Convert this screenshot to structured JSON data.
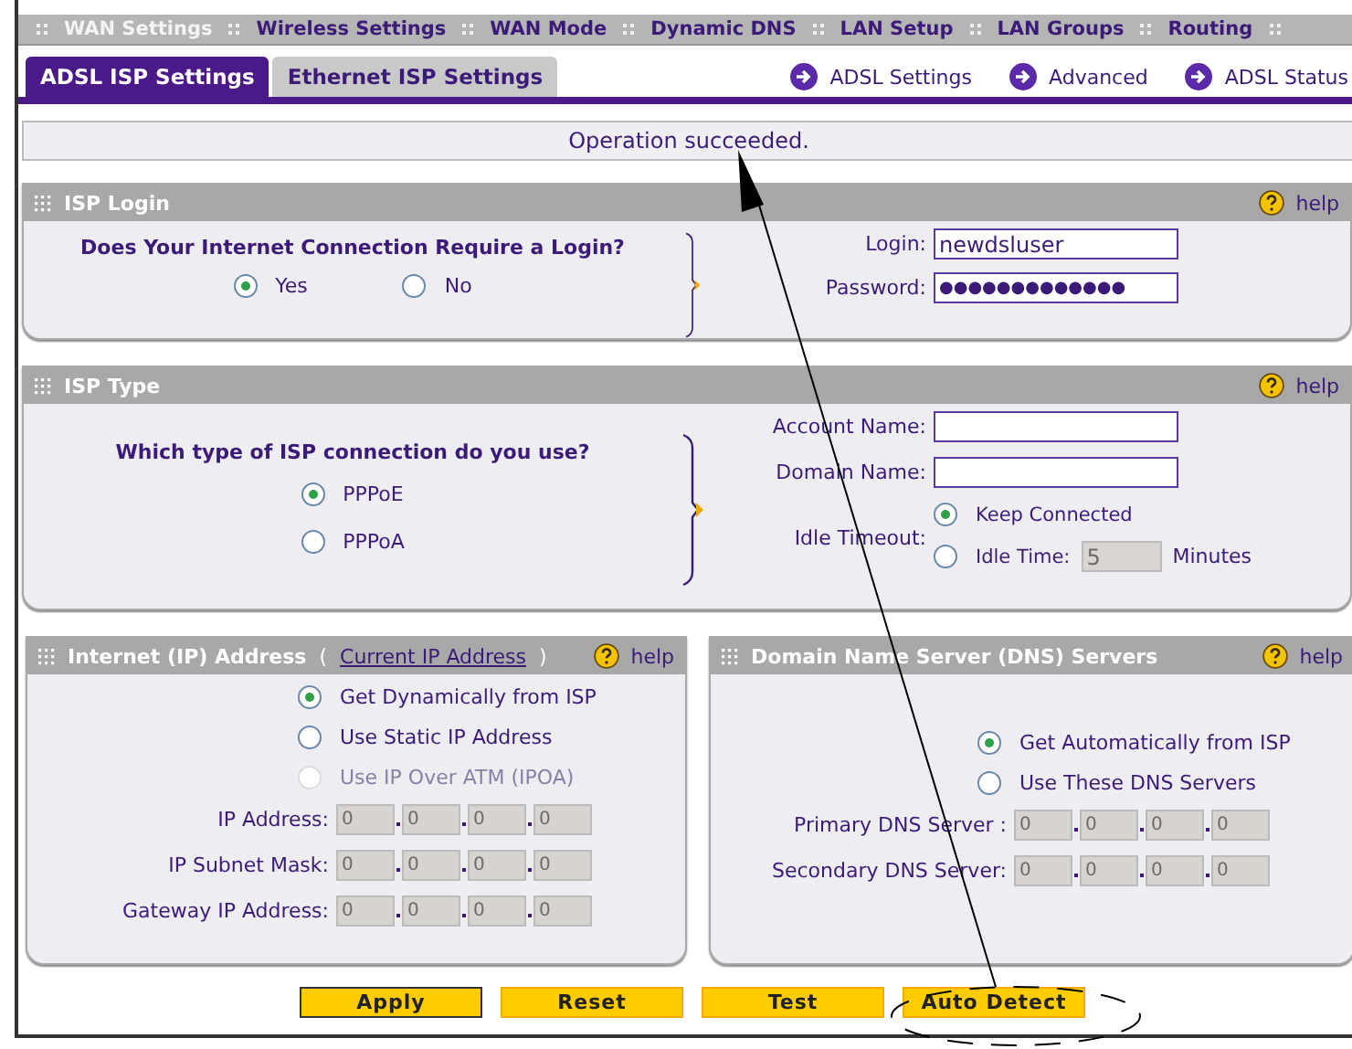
{
  "nav": [
    {
      "label": "WAN Settings",
      "selected": true
    },
    {
      "label": "Wireless Settings",
      "selected": false
    },
    {
      "label": "WAN Mode",
      "selected": false
    },
    {
      "label": "Dynamic DNS",
      "selected": false
    },
    {
      "label": "LAN Setup",
      "selected": false
    },
    {
      "label": "LAN Groups",
      "selected": false
    },
    {
      "label": "Routing",
      "selected": false
    }
  ],
  "tabs": [
    {
      "label": "ADSL ISP Settings",
      "selected": true
    },
    {
      "label": "Ethernet ISP Settings",
      "selected": false
    }
  ],
  "links": [
    "ADSL Settings",
    "Advanced",
    "ADSL Status"
  ],
  "message": "Operation succeeded.",
  "isp_login": {
    "title": "ISP Login",
    "help": "help",
    "question": "Does Your Internet Connection Require a Login?",
    "options": [
      {
        "label": "Yes",
        "selected": true
      },
      {
        "label": "No",
        "selected": false
      }
    ],
    "fields": [
      {
        "label": "Login:",
        "value": "newdsluser"
      },
      {
        "label": "Password:",
        "value": "●●●●●●●●●●●●●"
      }
    ]
  },
  "isp_type": {
    "title": "ISP Type",
    "help": "help",
    "question": "Which type of ISP connection do you use?",
    "options": [
      {
        "label": "PPPoE",
        "selected": true
      },
      {
        "label": "PPPoA",
        "selected": false
      }
    ],
    "fields": [
      {
        "label": "Account Name:"
      },
      {
        "label": "Domain Name:"
      }
    ],
    "idle_timeout": {
      "label": "Idle Timeout:",
      "options": [
        {
          "label": "Keep Connected",
          "selected": true
        },
        {
          "label": "Idle Time:",
          "selected": false,
          "value": "5",
          "unit": "Minutes"
        }
      ]
    }
  },
  "ip_address": {
    "title": "Internet (IP) Address",
    "paren_open": "(",
    "link": "Current IP Address",
    "paren_close": ")",
    "help": "help",
    "options": [
      {
        "label": "Get Dynamically from ISP",
        "selected": true,
        "disabled": false
      },
      {
        "label": "Use Static IP Address",
        "selected": false,
        "disabled": false
      },
      {
        "label": "Use IP Over ATM (IPOA)",
        "selected": false,
        "disabled": true
      }
    ],
    "fields": [
      {
        "label": "IP Address:",
        "octets": [
          "0",
          "0",
          "0",
          "0"
        ],
        "disabled": true
      },
      {
        "label": "IP Subnet Mask:",
        "octets": [
          "0",
          "0",
          "0",
          "0"
        ],
        "disabled": true
      },
      {
        "label": "Gateway IP Address:",
        "octets": [
          "0",
          "0",
          "0",
          "0"
        ],
        "disabled": true
      }
    ]
  },
  "dns": {
    "title": "Domain Name Server (DNS) Servers",
    "help": "help",
    "options": [
      {
        "label": "Get Automatically from ISP",
        "selected": true
      },
      {
        "label": "Use These DNS Servers",
        "selected": false
      }
    ],
    "fields": [
      {
        "label": "Primary DNS Server :",
        "octets": [
          "0",
          "0",
          "0",
          "0"
        ],
        "disabled": true
      },
      {
        "label": "Secondary DNS Server:",
        "octets": [
          "0",
          "0",
          "0",
          "0"
        ],
        "disabled": true
      }
    ]
  },
  "buttons": [
    {
      "label": "Apply",
      "kind": "primary"
    },
    {
      "label": "Reset",
      "kind": "plain"
    },
    {
      "label": "Test",
      "kind": "plain"
    },
    {
      "label": "Auto Detect",
      "kind": "plain"
    }
  ]
}
